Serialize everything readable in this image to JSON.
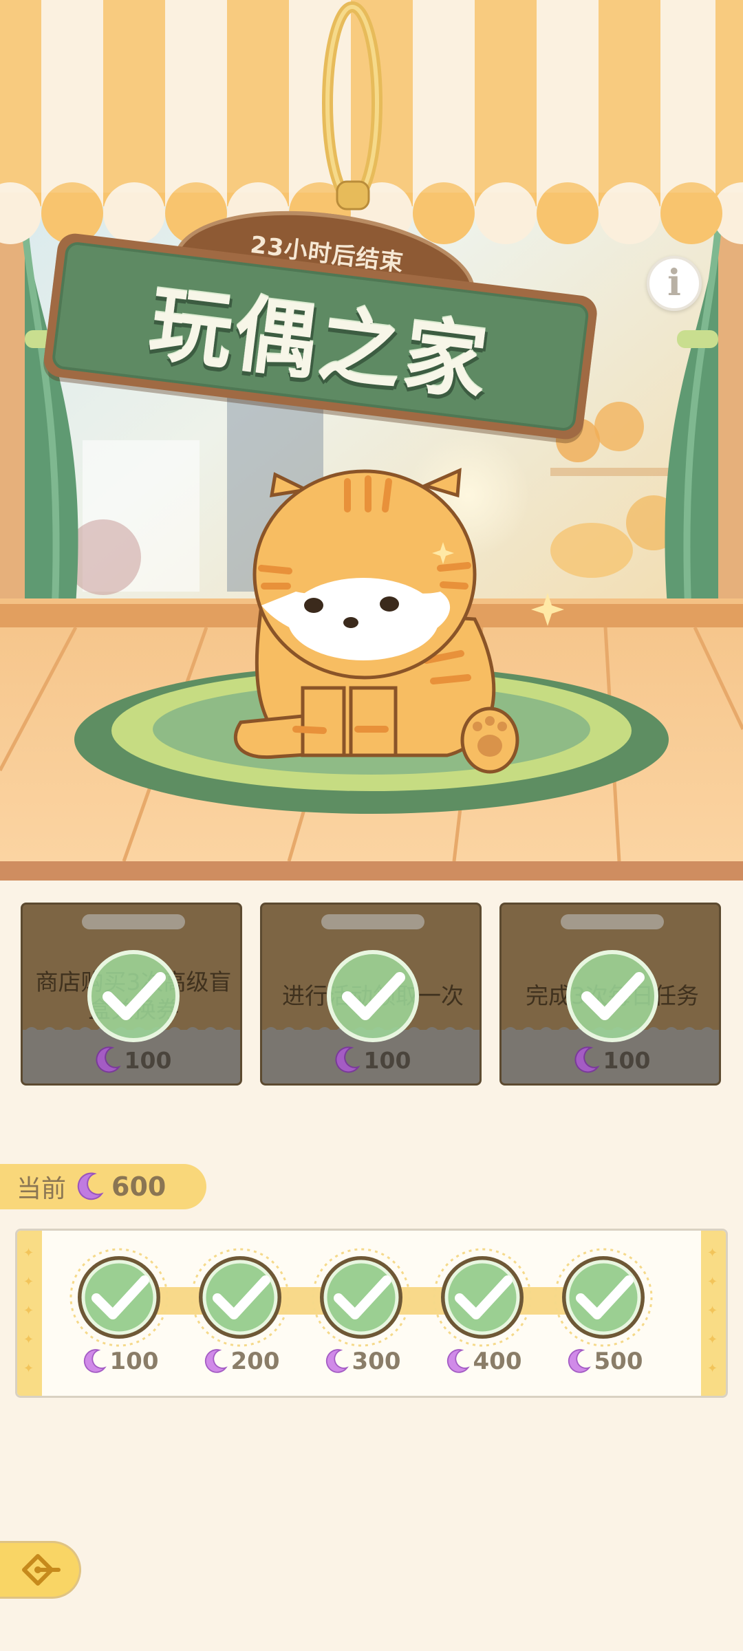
{
  "event": {
    "timer_text": "23小时后结束",
    "title": "玩偶之家"
  },
  "info_button": {
    "icon": "info-icon",
    "glyph": "i"
  },
  "tasks": [
    {
      "text": "商店购买3次高级盲盒兑换券",
      "reward": "100",
      "completed": true
    },
    {
      "text": "进行活动领取一次",
      "reward": "100",
      "completed": true
    },
    {
      "text": "完成3次每日任务",
      "reward": "100",
      "completed": true
    }
  ],
  "current": {
    "label": "当前",
    "value": "600"
  },
  "milestones": [
    {
      "value": "100",
      "completed": true
    },
    {
      "value": "200",
      "completed": true
    },
    {
      "value": "300",
      "completed": true
    },
    {
      "value": "400",
      "completed": true
    },
    {
      "value": "500",
      "completed": true
    }
  ],
  "back_button": {
    "icon": "back-arrow-icon"
  },
  "colors": {
    "moon": "#a45cc4",
    "check_fill": "#9ed99a",
    "sign_green": "#5e8a63",
    "awning_orange": "#f8c46e",
    "current_bar": "#f9d77a"
  }
}
